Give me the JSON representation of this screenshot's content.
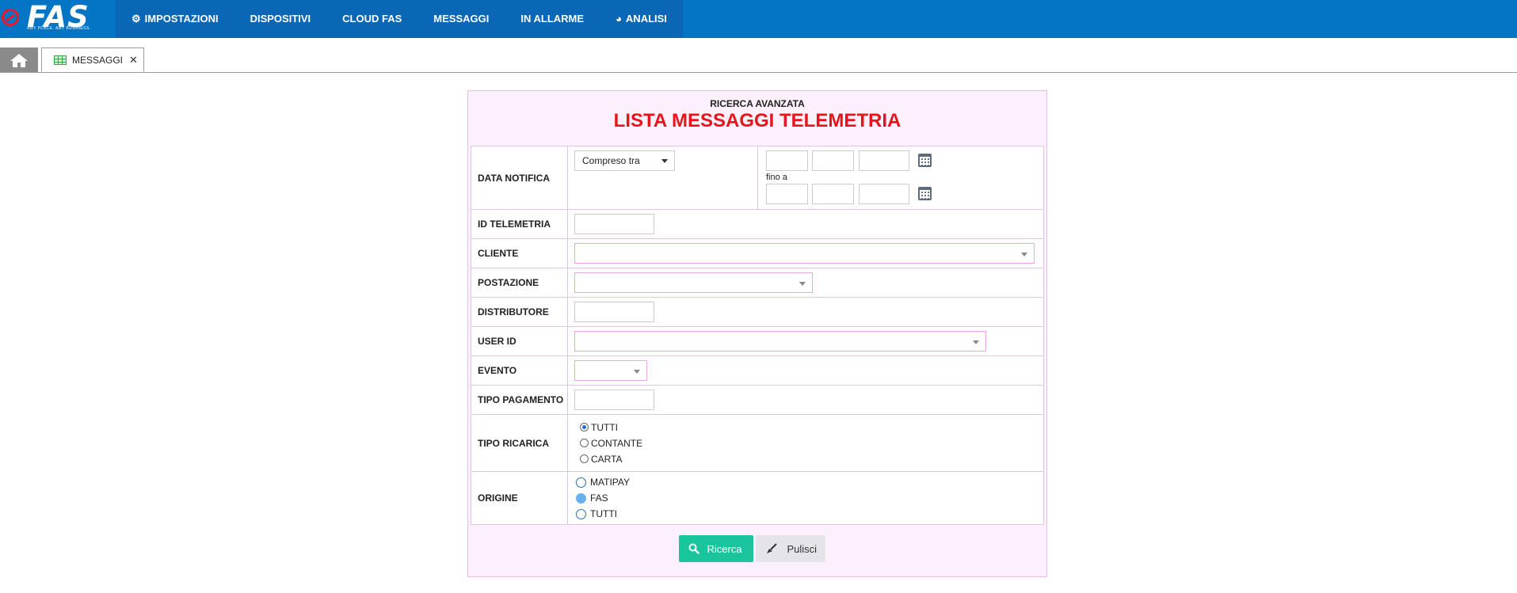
{
  "header": {
    "logo_text": "FAS",
    "logo_tagline": "ANY PLACE. ANY BUSINESS.",
    "menu": [
      {
        "label": "IMPOSTAZIONI",
        "icon": "gear-icon"
      },
      {
        "label": "DISPOSITIVI"
      },
      {
        "label": "CLOUD FAS"
      },
      {
        "label": "MESSAGGI"
      },
      {
        "label": "IN ALLARME"
      },
      {
        "label": "ANALISI",
        "icon": "pie-chart-icon"
      }
    ]
  },
  "tabs": {
    "home_icon": "home-icon",
    "active_tab": {
      "label": "MESSAGGI",
      "icon": "grid-icon",
      "close": "✕"
    }
  },
  "form": {
    "subtitle": "RICERCA AVANZATA",
    "title": "LISTA MESSAGGI TELEMETRIA",
    "data_notifica": {
      "label": "DATA NOTIFICA",
      "range_select": "Compreso tra",
      "to_label": "fino a"
    },
    "id_telemetria": {
      "label": "ID TELEMETRIA",
      "value": ""
    },
    "cliente": {
      "label": "CLIENTE",
      "value": ""
    },
    "postazione": {
      "label": "POSTAZIONE",
      "value": ""
    },
    "distributore": {
      "label": "DISTRIBUTORE",
      "value": ""
    },
    "user_id": {
      "label": "USER ID",
      "value": ""
    },
    "evento": {
      "label": "EVENTO",
      "value": ""
    },
    "tipo_pagamento": {
      "label": "TIPO PAGAMENTO",
      "value": ""
    },
    "tipo_ricarica": {
      "label": "TIPO RICARICA",
      "options": [
        "TUTTI",
        "CONTANTE",
        "CARTA"
      ],
      "selected": "TUTTI"
    },
    "origine": {
      "label": "ORIGINE",
      "options": [
        "MATIPAY",
        "FAS",
        "TUTTI"
      ],
      "selected": "FAS"
    },
    "buttons": {
      "search": "Ricerca",
      "clear": "Pulisci"
    }
  },
  "colors": {
    "topbar": "#0474c4",
    "menu_bg": "#0a67b6",
    "title_red": "#e8141c",
    "panel_bg": "#fbf0fb",
    "search_button": "#19c59c"
  }
}
